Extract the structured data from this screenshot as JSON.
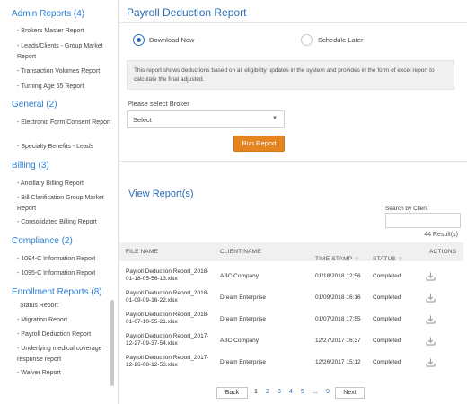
{
  "sidebar": {
    "groups": [
      {
        "title": "Admin Reports (4)",
        "items": [
          "Brokers Master Report",
          "Leads/Clients - Group Market Report",
          "Transaction Volumes Report",
          "Turning Age 65 Report"
        ]
      },
      {
        "title": "General (2)",
        "items": [
          "Electronic Form Consent Report",
          "Specialty Benefits - Leads"
        ]
      },
      {
        "title": "Billing (3)",
        "items": [
          "Ancillary Billing Report",
          "Bill Clarification Group Market Report",
          "Consolidated Billing Report"
        ]
      },
      {
        "title": "Compliance (2)",
        "items": [
          "1094-C Information Report",
          "1095-C Information Report"
        ]
      },
      {
        "title": "Enrollment Reports (8)",
        "items": [
          "Status Report",
          "Migration Report",
          "Payroll Deduction Report",
          "Underlying medical coverage response report",
          "Waiver Report"
        ]
      }
    ]
  },
  "main": {
    "title": "Payroll Deduction Report",
    "radio_download": "Download Now",
    "radio_schedule": "Schedule Later",
    "info_text": "This report shows deductions based on all eligibility updates in the system and provides in the form of excel report to calculate the final adjusted.",
    "select_label": "Please select Broker",
    "select_value": "Select",
    "run_button": "Run Report",
    "view_title": "View Report(s)",
    "search_label": "Search by Client",
    "results_count": "44 Result(s)",
    "columns": [
      "FILE NAME",
      "CLIENT NAME",
      "TIME STAMP",
      "STATUS",
      "ACTIONS"
    ],
    "rows": [
      {
        "file_line1": "Payroll Deduction Report_2018-",
        "file_line2": "01-18-05-56-13.xlsx",
        "client": "ABC Company",
        "stamp": "01/18/2018 12:56",
        "status": "Completed"
      },
      {
        "file_line1": "Payroll Deduction Report_2018-",
        "file_line2": "01-09-09-16-22.xlsx",
        "client": "Dream Enterprise",
        "stamp": "01/09/2018 16:16",
        "status": "Completed"
      },
      {
        "file_line1": "Payroll Deduction Report_2018-",
        "file_line2": "01-07-10-55-21.xlsx",
        "client": "Dream Enterprise",
        "stamp": "01/07/2018 17:55",
        "status": "Completed"
      },
      {
        "file_line1": "Payroll Deduction Report_2017-",
        "file_line2": "12-27-09-37-54.xlsx",
        "client": "ABC Company",
        "stamp": "12/27/2017 16:37",
        "status": "Completed"
      },
      {
        "file_line1": "Payroll Deduction Report_2017-",
        "file_line2": "12-26-08-12-53.xlsx",
        "client": "Dream Enterprise",
        "stamp": "12/26/2017 15:12",
        "status": "Completed"
      }
    ],
    "pager": {
      "back": "Back",
      "next": "Next",
      "pages": [
        "1",
        "2",
        "3",
        "4",
        "5"
      ],
      "ellipsis": "...",
      "last": "9"
    }
  },
  "colors": {
    "accent": "#2a6cb0",
    "button": "#e58522",
    "title": "#2a7fd4"
  }
}
